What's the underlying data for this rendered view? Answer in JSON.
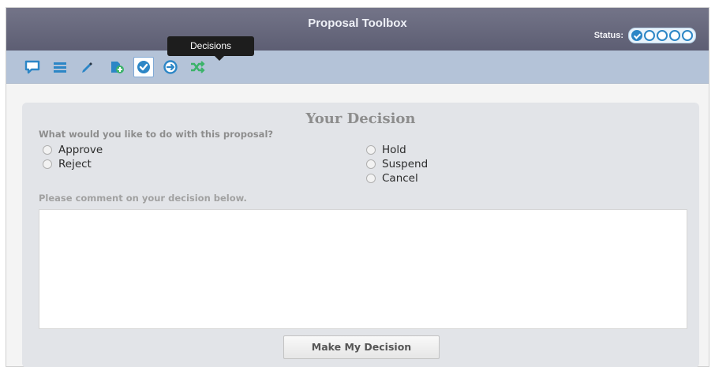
{
  "window": {
    "title": "Proposal Toolbox"
  },
  "status": {
    "label": "Status:",
    "steps_total": 5,
    "steps_complete": 1
  },
  "tooltip": {
    "text": "Decisions"
  },
  "toolbar": {
    "items": [
      {
        "icon": "comment-icon",
        "active": false
      },
      {
        "icon": "list-icon",
        "active": false
      },
      {
        "icon": "pencil-icon",
        "active": false
      },
      {
        "icon": "add-document-icon",
        "active": false
      },
      {
        "icon": "checkmark-icon",
        "active": true
      },
      {
        "icon": "arrow-circle-icon",
        "active": false
      },
      {
        "icon": "shuffle-icon",
        "active": false
      }
    ]
  },
  "decision": {
    "title": "Your Decision",
    "question": "What would you like to do with this proposal?",
    "options_left": [
      "Approve",
      "Reject"
    ],
    "options_right": [
      "Hold",
      "Suspend",
      "Cancel"
    ],
    "comment_label": "Please comment on your decision below.",
    "comment_value": "",
    "submit_label": "Make My Decision"
  },
  "colors": {
    "titlebar": "#66677c",
    "toolbar": "#b4c3d8",
    "accent": "#2c86c6",
    "panel": "#e2e4e8"
  }
}
